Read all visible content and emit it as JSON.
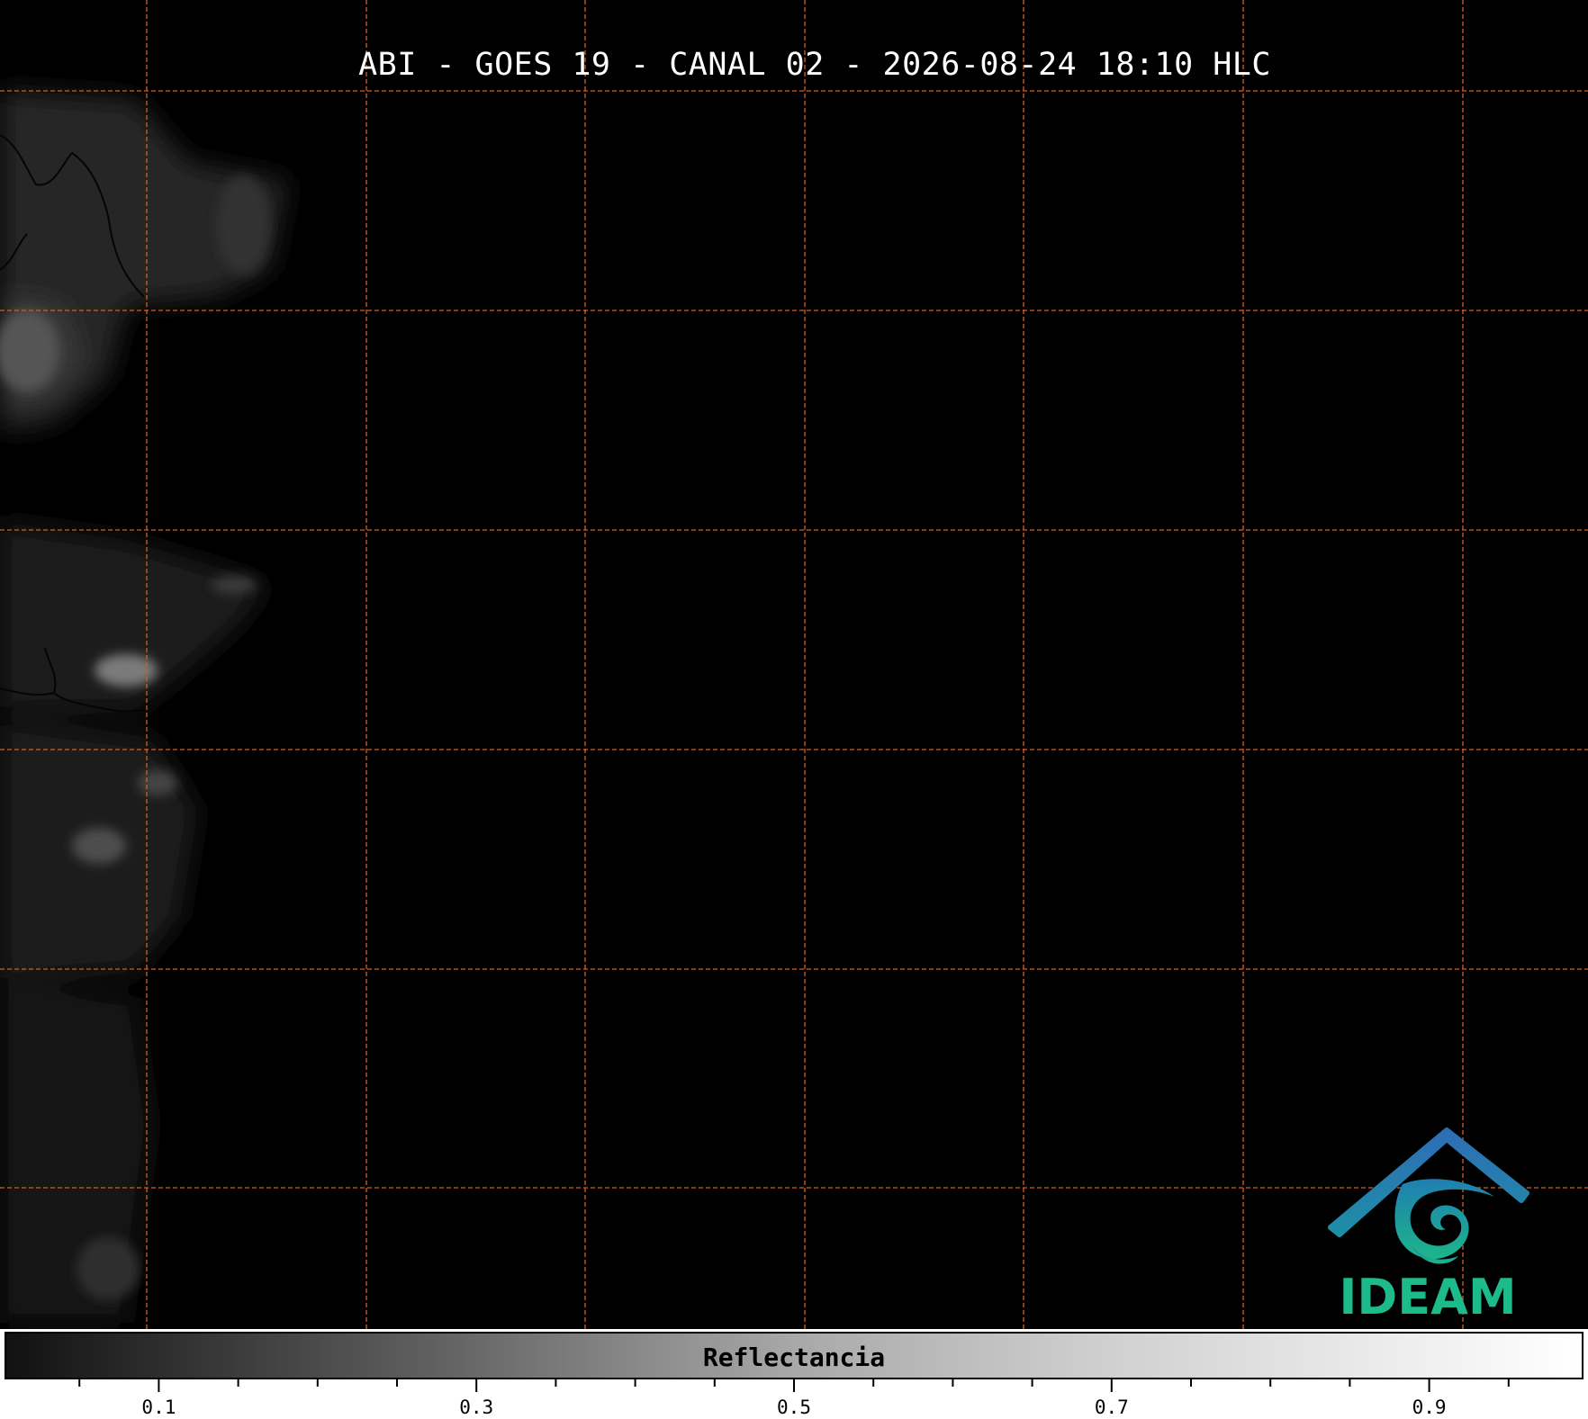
{
  "title": "ABI - GOES 19 - CANAL 02 - 2026-08-24 18:10 HLC",
  "map": {
    "background": "#000000",
    "gridline_color": "#c8642a",
    "gridline_style": "dashed"
  },
  "logo": {
    "text": "IDEAM",
    "text_color": "#1dba8a",
    "roof_color": "#2e6db5"
  },
  "colorbar": {
    "label": "Reflectancia",
    "range": [
      0,
      1
    ],
    "colormap": "grayscale",
    "tick_labels": [
      "0.1",
      "0.3",
      "0.5",
      "0.7",
      "0.9"
    ],
    "major_ticks": [
      0.1,
      0.3,
      0.5,
      0.7,
      0.9
    ],
    "minor_ticks": [
      0.05,
      0.15,
      0.2,
      0.25,
      0.35,
      0.4,
      0.45,
      0.55,
      0.6,
      0.65,
      0.75,
      0.8,
      0.85,
      0.95
    ]
  }
}
